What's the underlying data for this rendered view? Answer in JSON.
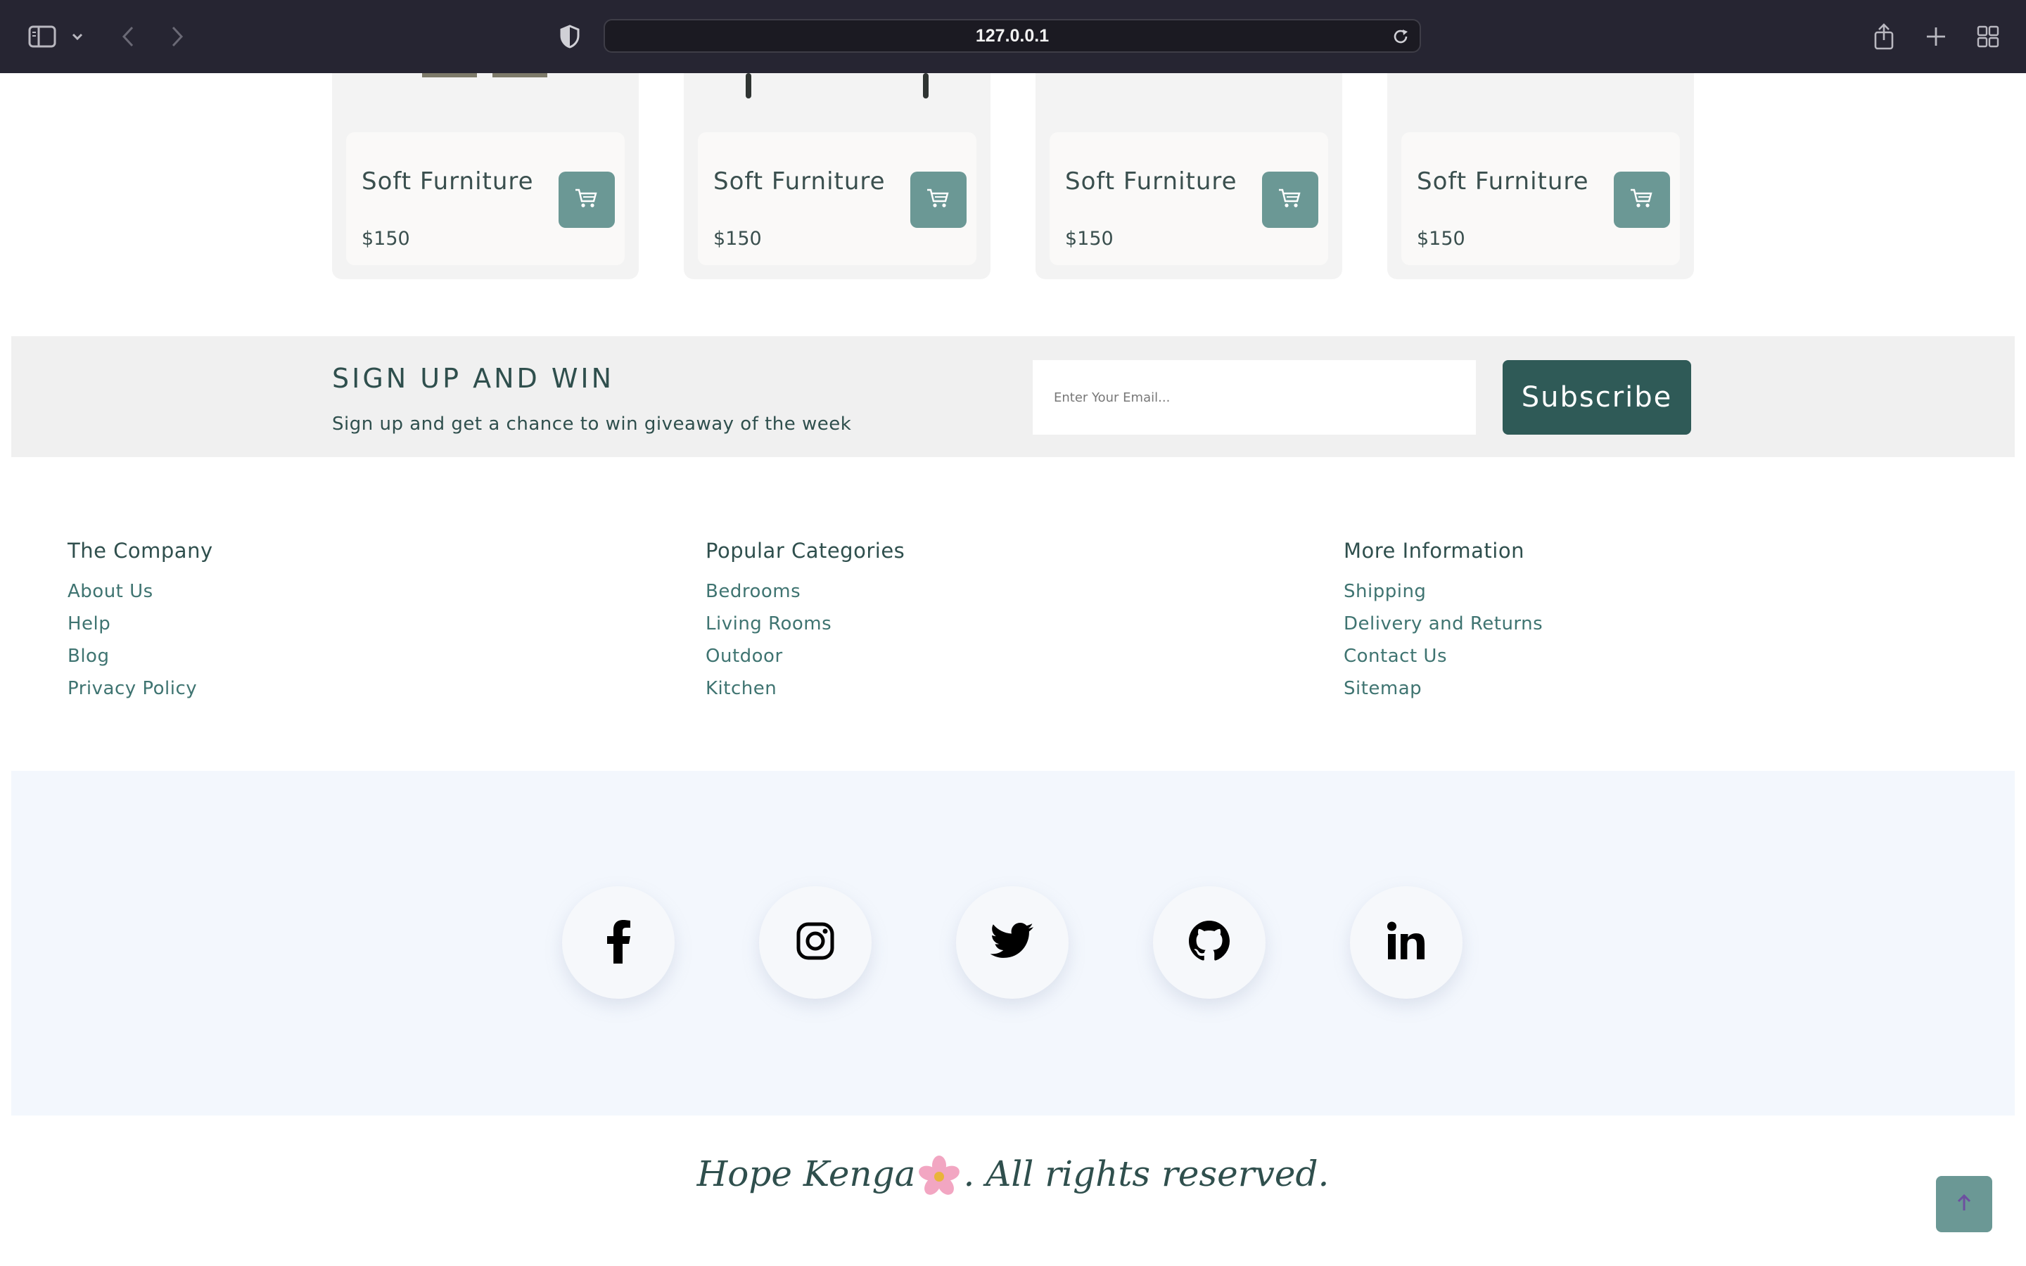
{
  "browser": {
    "url": "127.0.0.1"
  },
  "products": [
    {
      "name": "Soft Furniture",
      "price": "$150"
    },
    {
      "name": "Soft Furniture",
      "price": "$150"
    },
    {
      "name": "Soft Furniture",
      "price": "$150"
    },
    {
      "name": "Soft Furniture",
      "price": "$150"
    }
  ],
  "newsletter": {
    "title": "SIGN UP AND WIN",
    "subtitle": "Sign up and get a chance to win giveaway of the week",
    "email_placeholder": "Enter Your Email...",
    "subscribe_label": "Subscribe"
  },
  "footer": {
    "columns": [
      {
        "heading": "The Company",
        "links": [
          "About Us",
          "Help",
          "Blog",
          "Privacy Policy"
        ]
      },
      {
        "heading": "Popular Categories",
        "links": [
          "Bedrooms",
          "Living Rooms",
          "Outdoor",
          "Kitchen"
        ]
      },
      {
        "heading": "More Information",
        "links": [
          "Shipping",
          "Delivery and Returns",
          "Contact Us",
          "Sitemap"
        ]
      }
    ],
    "social": [
      "facebook-icon",
      "instagram-icon",
      "twitter-icon",
      "github-icon",
      "linkedin-icon"
    ],
    "copyright_author": "Hope Kenga",
    "copyright_suffix": ". All rights reserved.",
    "colors": {
      "accent": "#6b9895",
      "dark_accent": "#2f5a57",
      "text": "#2f4f4d"
    }
  }
}
